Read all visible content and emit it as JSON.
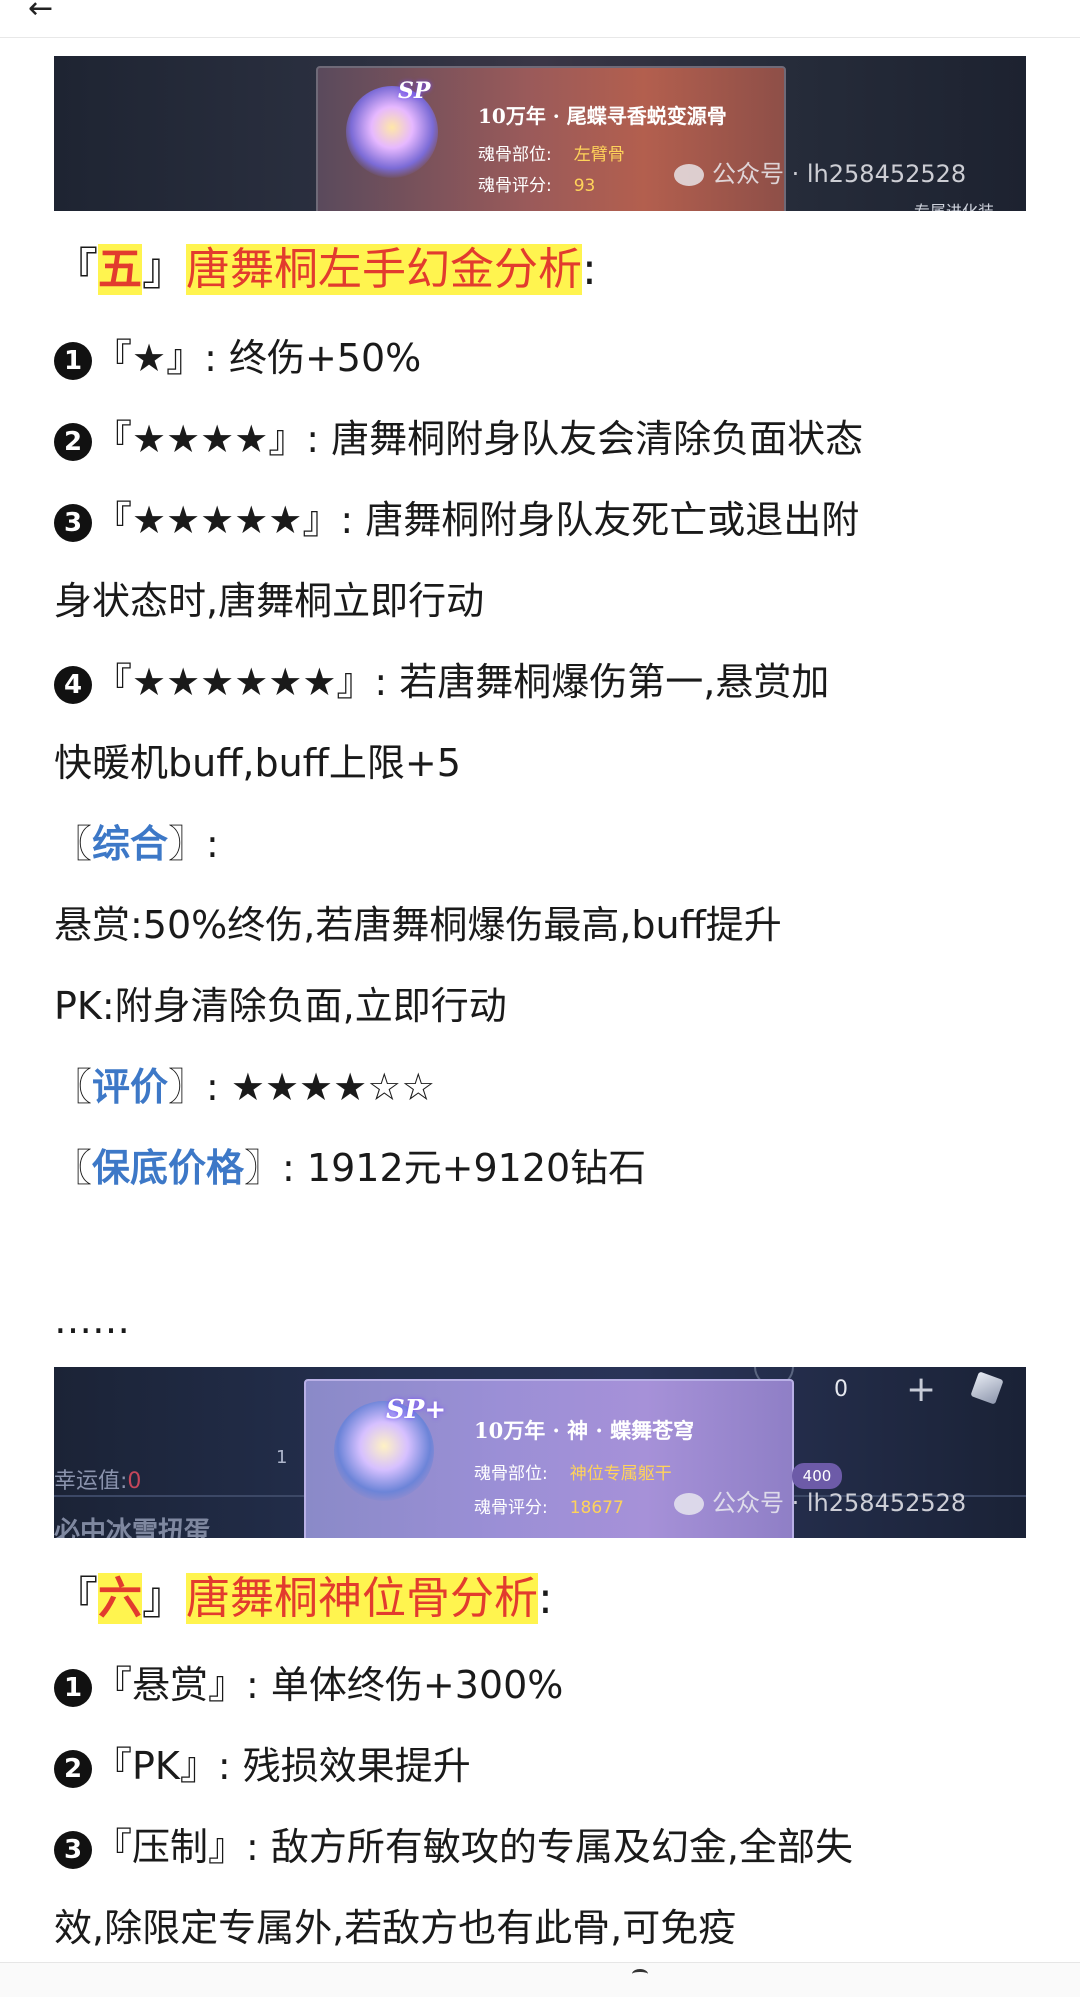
{
  "nav": {
    "back_label": "←"
  },
  "banner1": {
    "sp_label": "SP",
    "title": "10万年 · 尾蝶寻香蜕变源骨",
    "part_label": "魂骨部位:",
    "part_value": "左臂骨",
    "score_label": "魂骨评分:",
    "score_value": "93",
    "watermark": "公众号 · lh258452528",
    "corner_text": "专属进化装"
  },
  "section5": {
    "open_bracket": "『",
    "number": "五",
    "close_bracket": "』",
    "title": "唐舞桐左手幻金分析",
    "colon": ":",
    "items": [
      {
        "num": "1",
        "text": "『★』: 终伤+50%"
      },
      {
        "num": "2",
        "text": "『★★★★』: 唐舞桐附身队友会清除负面状态"
      },
      {
        "num": "3",
        "text": "『★★★★★』: 唐舞桐附身队友死亡或退出附"
      },
      {
        "num": "",
        "text": "身状态时,唐舞桐立即行动"
      },
      {
        "num": "4",
        "text": "『★★★★★★』: 若唐舞桐爆伤第一,悬赏加"
      },
      {
        "num": "",
        "text": "快暖机buff,buff上限+5"
      }
    ],
    "summary_label": "综合",
    "summary_lines": [
      "悬赏:50%终伤,若唐舞桐爆伤最高,buff提升",
      "PK:附身清除负面,立即行动"
    ],
    "rating_label": "评价",
    "rating_stars": "★★★★☆☆",
    "price_label": "保底价格",
    "price_value": "1912元+9120钻石",
    "ellipsis": "……"
  },
  "banner2": {
    "sp_label": "SP+",
    "title": "10万年 · 神 · 蝶舞苍穹",
    "part_label": "魂骨部位:",
    "part_value": "神位专属躯干",
    "score_label": "魂骨评分:",
    "score_value": "18677",
    "watermark": "公众号 · lh258452528",
    "luck_label": "幸运值:",
    "luck_value": "0",
    "one_label": "1",
    "counter": "0",
    "plus": "+",
    "badge_400": "400",
    "bottom_text": "必中冰雪扭蛋"
  },
  "section6": {
    "open_bracket": "『",
    "number": "六",
    "close_bracket": "』",
    "title": "唐舞桐神位骨分析",
    "colon": ":",
    "items": [
      {
        "num": "1",
        "text": "『悬赏』: 单体终伤+300%"
      },
      {
        "num": "2",
        "text": "『PK』: 残损效果提升"
      },
      {
        "num": "3",
        "text": "『压制』: 敌方所有敏攻的专属及幻金,全部失"
      },
      {
        "num": "",
        "text": "效,除限定专属外,若敌方也有此骨,可免疫"
      }
    ]
  }
}
